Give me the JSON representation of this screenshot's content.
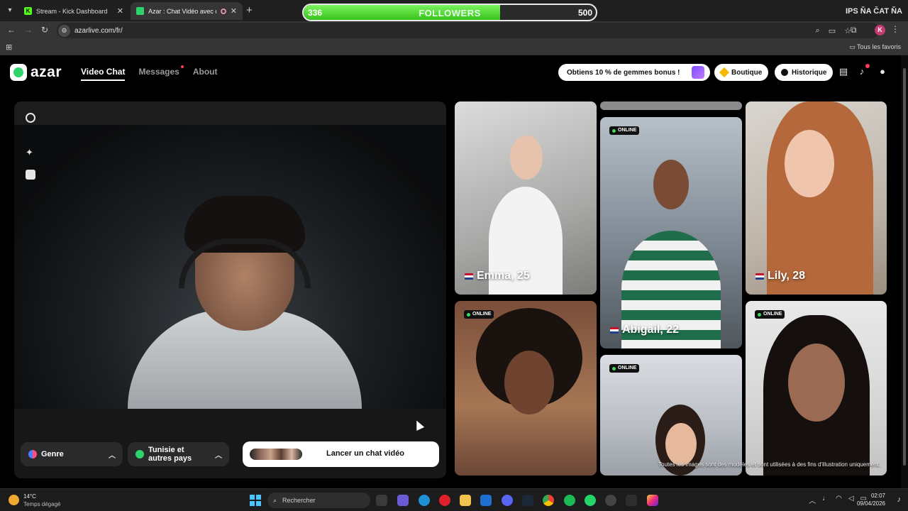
{
  "browser": {
    "tabs": [
      {
        "label": "Stream - Kick Dashboard",
        "icon": "kick-icon",
        "color": "#53fc18"
      },
      {
        "label": "Azar : Chat Vidéo avec de n",
        "icon": "azar-icon",
        "color": "#2ed36b"
      }
    ],
    "url": "azarlive.com/fr/",
    "bookmarks_label": "Tous les favoris",
    "profile_letter": "K"
  },
  "overlay": {
    "followers_current": "336",
    "followers_label": "FOLLOWERS",
    "followers_goal": "500",
    "followers_progress": 0.672,
    "ticker": "IPS  ŇA  ČAT  ŇA"
  },
  "header": {
    "logo_text": "azar",
    "nav": {
      "video_chat": "Video Chat",
      "messages": "Messages",
      "about": "About"
    },
    "bonus_label": "Obtiens 10 % de gemmes bonus !",
    "boutique_label": "Boutique",
    "history_label": "Historique"
  },
  "video": {
    "genre_label": "Genre",
    "region_label": "Tunisie et autres pays",
    "launch_label": "Lancer un chat vidéo"
  },
  "grid": {
    "online_label": "ONLINE",
    "profiles": [
      {
        "name": "Emma, 25",
        "flag": "us-flag"
      },
      {
        "name": "Abigail, 22",
        "flag": "us-flag"
      },
      {
        "name": "Lily, 28",
        "flag": "us-flag"
      }
    ],
    "disclaimer": "Toutes les images sont des modèles et sont utilisées à des fins d'illustration uniquement."
  },
  "taskbar": {
    "weather_temp": "14°C",
    "weather_desc": "Temps dégagé",
    "search_placeholder": "Rechercher",
    "time": "02:07",
    "date": "09/04/2026"
  }
}
